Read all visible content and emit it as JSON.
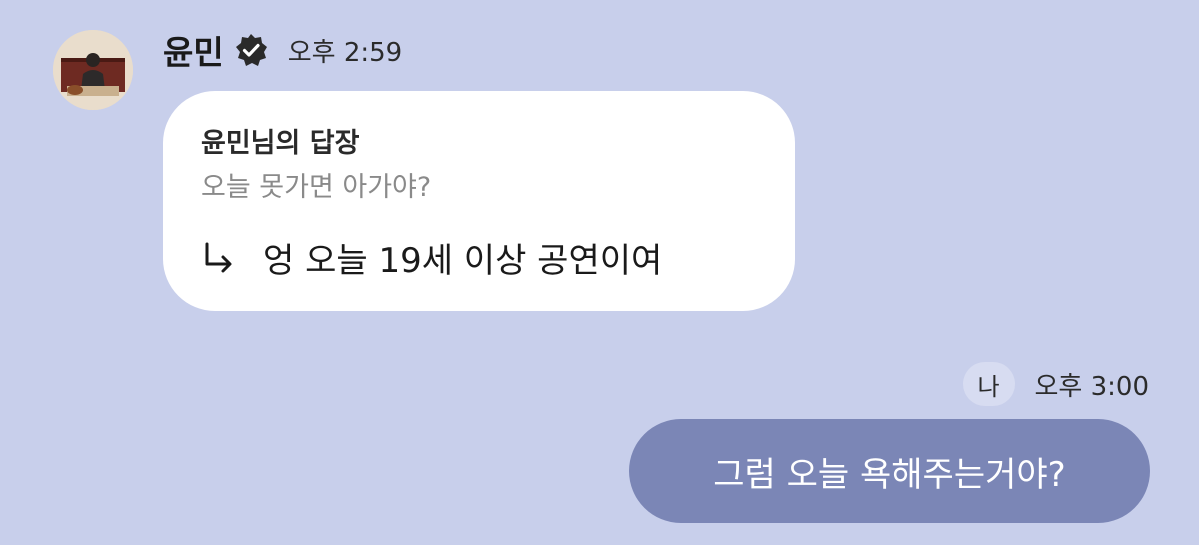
{
  "colors": {
    "background": "#c8cfeb",
    "incoming_bubble": "#ffffff",
    "outgoing_bubble": "#7b86b6",
    "me_badge": "#d7dcf1"
  },
  "incoming": {
    "sender_name": "윤민",
    "verified_icon": "verified-badge-icon",
    "time": "오후 2:59",
    "reply": {
      "header": "윤민님의 답장",
      "quoted_text": "오늘 못가면 아가야?",
      "arrow_icon": "reply-arrow-icon",
      "text": "엉 오늘 19세 이상 공연이여"
    }
  },
  "outgoing": {
    "me_label": "나",
    "time": "오후 3:00",
    "text": "그럼 오늘 욕해주는거야?"
  }
}
